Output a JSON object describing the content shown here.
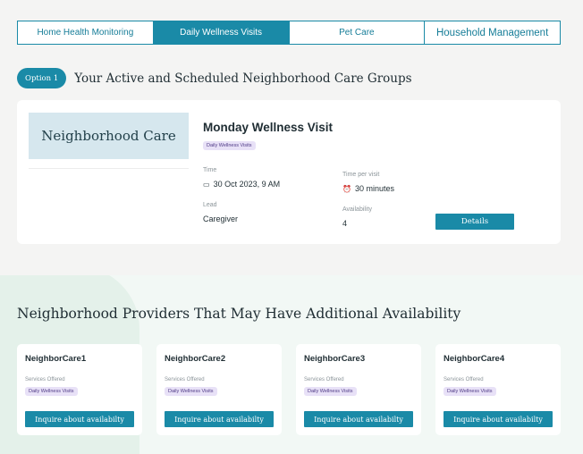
{
  "tabs": [
    {
      "label": "Home Health Monitoring",
      "active": false
    },
    {
      "label": "Daily Wellness Visits",
      "active": true
    },
    {
      "label": "Pet Care",
      "active": false
    },
    {
      "label": "Household Management",
      "active": false
    }
  ],
  "active_section": {
    "pill": "Option 1",
    "title": "Your Active and Scheduled Neighborhood Care Groups"
  },
  "visit_card": {
    "logo_text": "Neighborhood Care",
    "title": "Monday Wellness Visit",
    "tag": "Daily Wellness Visits",
    "time_label": "Time",
    "time_value": "30 Oct 2023, 9 AM",
    "time_icon": "calendar-icon",
    "per_visit_label": "Time per visit",
    "per_visit_value": "30 minutes",
    "per_visit_icon": "alarm-clock-icon",
    "lead_label": "Lead",
    "lead_value": "Caregiver",
    "availability_label": "Availability",
    "availability_value": "4",
    "details_label": "Details"
  },
  "providers_section": {
    "title": "Neighborhood Providers That May Have Additional Availability",
    "providers": [
      {
        "name": "NeighborCare1",
        "services_label": "Services Offered",
        "tag": "Daily Wellness Visits",
        "button": "Inquire about availabilty"
      },
      {
        "name": "NeighborCare2",
        "services_label": "Services Offered",
        "tag": "Daily Wellness Visits",
        "button": "Inquire about availabilty"
      },
      {
        "name": "NeighborCare3",
        "services_label": "Services Offered",
        "tag": "Daily Wellness Visits",
        "button": "Inquire about availabilty"
      },
      {
        "name": "NeighborCare4",
        "services_label": "Services Offered",
        "tag": "Daily Wellness Visits",
        "button": "Inquire about availabilty"
      }
    ]
  },
  "colors": {
    "accent": "#1a8aa7",
    "tag_bg": "#e8e1f7",
    "logo_bg": "#d6e7ee",
    "lower_bg": "#f2f8f5"
  }
}
